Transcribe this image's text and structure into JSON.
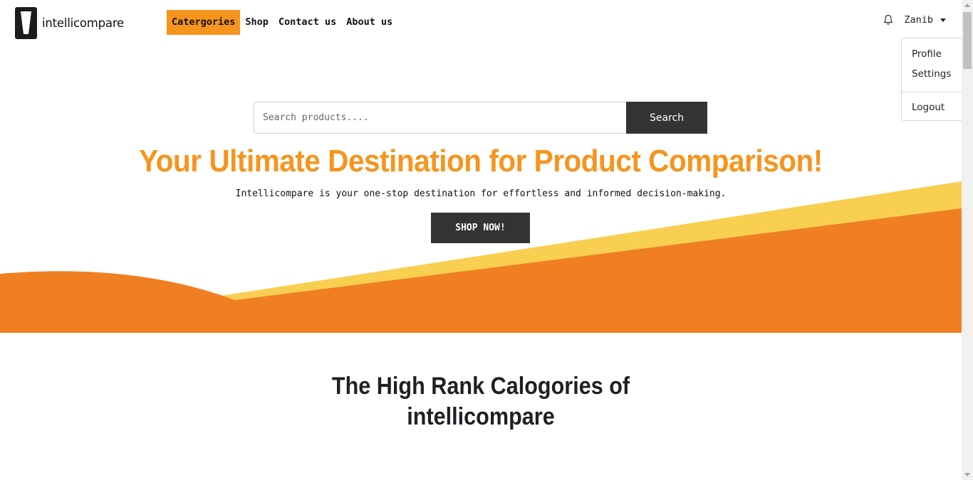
{
  "brand": {
    "name": "intellicompare"
  },
  "nav": {
    "items": [
      {
        "label": "Catergories",
        "active": true
      },
      {
        "label": "Shop"
      },
      {
        "label": "Contact us"
      },
      {
        "label": "About us"
      }
    ]
  },
  "user": {
    "name": "Zanib",
    "menu": {
      "profile": "Profile",
      "settings": "Settings",
      "logout": "Logout"
    }
  },
  "search": {
    "placeholder": "Search products....",
    "value": "",
    "button_label": "Search"
  },
  "hero": {
    "title": "Your Ultimate Destination for Product Comparison!",
    "subtitle": "Intellicompare is your one-stop destination for effortless and informed decision-making.",
    "cta_label": "SHOP NOW!"
  },
  "categories": {
    "title_line1": "The High Rank Calogories of",
    "title_line2": "intellicompare"
  },
  "icons": {
    "bell": "bell-icon",
    "caret": "caret-down-icon",
    "logo": "logo-mark-icon"
  },
  "colors": {
    "accent": "#f7941d",
    "orange_wave": "#f07f22",
    "yellow_band": "#f9cf52",
    "dark_button": "#333333"
  }
}
